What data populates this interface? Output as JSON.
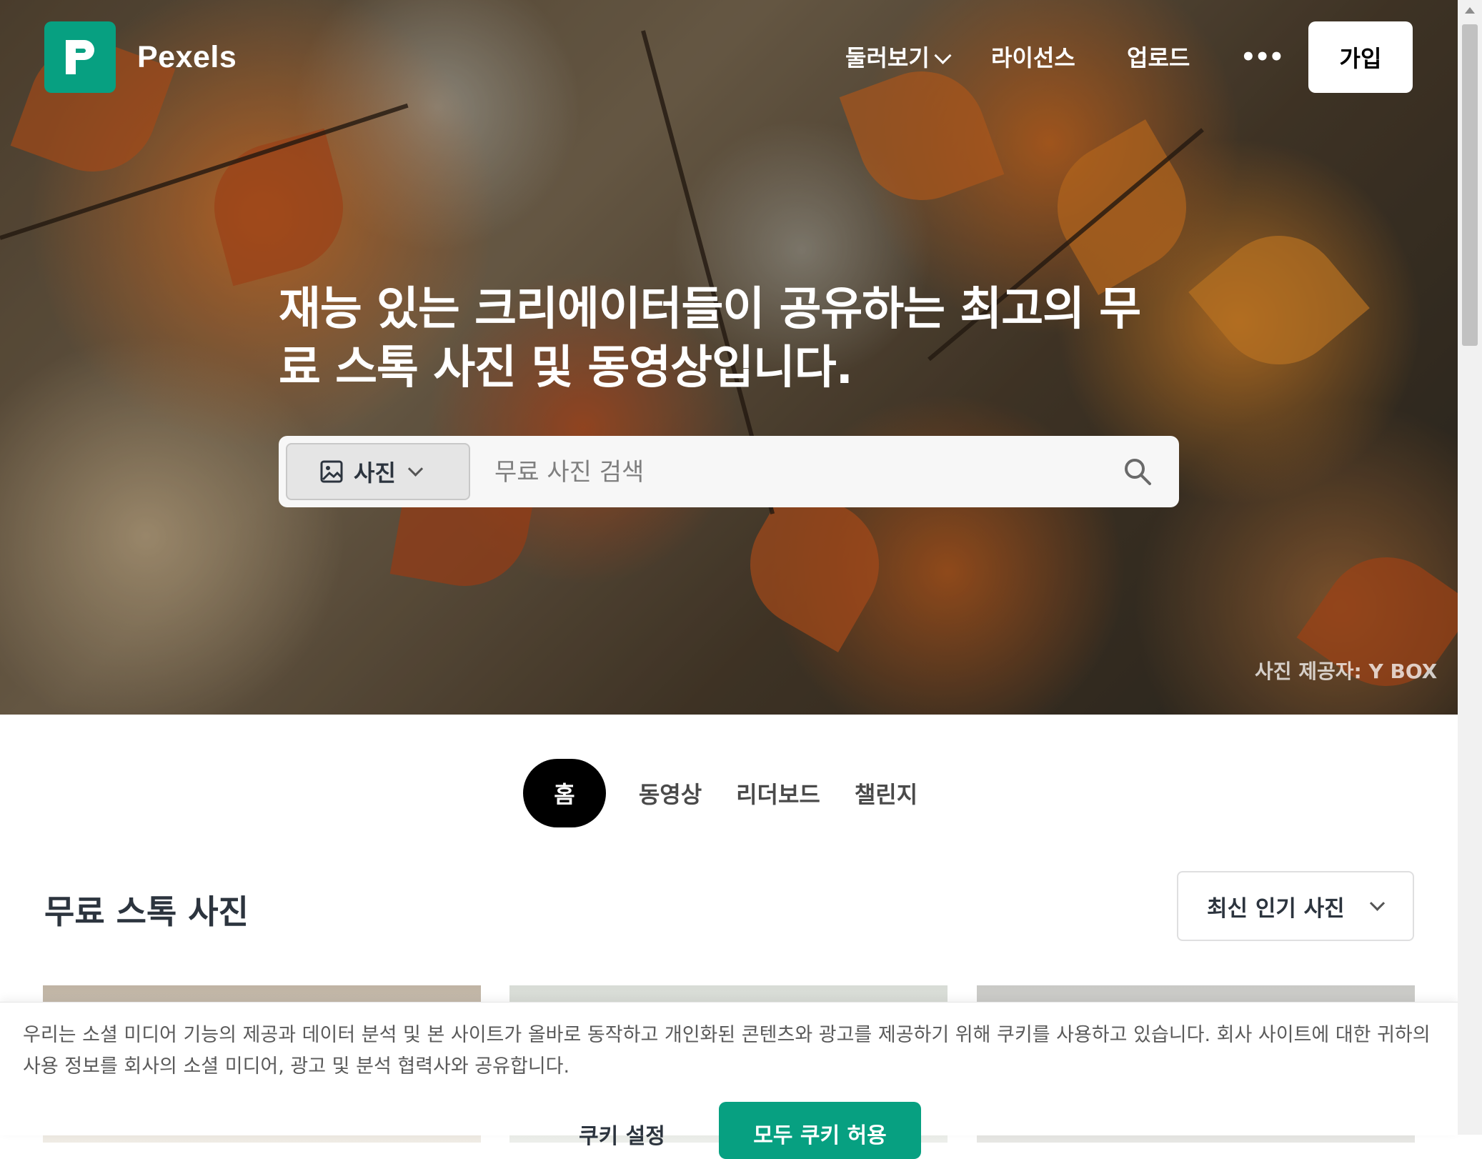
{
  "brand": {
    "name": "Pexels",
    "logo_color": "#07a081"
  },
  "nav": {
    "browse": "둘러보기",
    "license": "라이선스",
    "upload": "업로드",
    "more": "•••",
    "join": "가입"
  },
  "hero": {
    "title": "재능 있는 크리에이터들이 공유하는 최고의 무료 스톡 사진 및 동영상입니다.",
    "credit": "사진 제공자: Y BOX"
  },
  "search": {
    "type_label": "사진",
    "placeholder": "무료 사진 검색",
    "icon": "search-icon"
  },
  "tabs": [
    "홈",
    "동영상",
    "리더보드",
    "챌린지"
  ],
  "section": {
    "title": "무료 스톡 사진",
    "sort_label": "최신 인기 사진"
  },
  "cookie": {
    "text": "우리는 소셜 미디어 기능의 제공과 데이터 분석 및 본 사이트가 올바로 동작하고 개인화된 콘텐츠와 광고를 제공하기 위해 쿠키를 사용하고 있습니다. 회사 사이트에 대한 귀하의 사용 정보를 회사의 소셜 미디어, 광고 및 분석 협력사와 공유합니다.",
    "settings": "쿠키 설정",
    "accept": "모두 쿠키 허용",
    "accent": "#07a081"
  }
}
